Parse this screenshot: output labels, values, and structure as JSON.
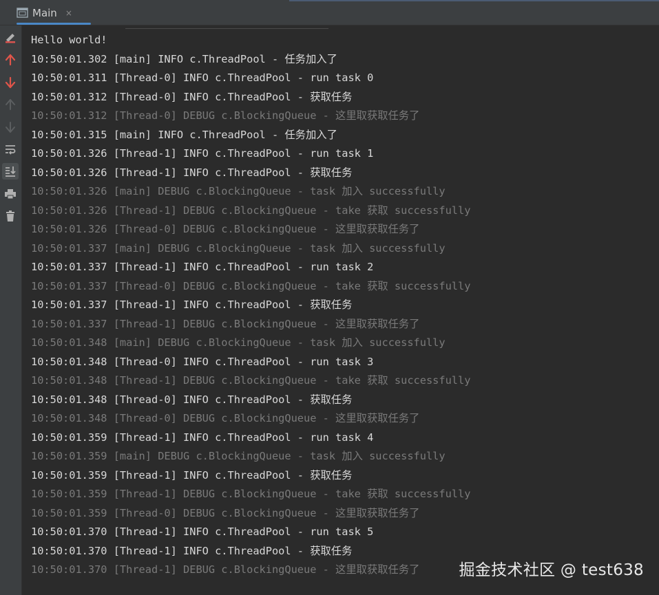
{
  "tab": {
    "title": "Main",
    "close": "×"
  },
  "toolbar": [
    {
      "name": "clear-output-icon",
      "glyph": "✎",
      "color": "#d9534f"
    },
    {
      "name": "arrow-up-red-icon",
      "glyph": "↑",
      "color": "#e0554a"
    },
    {
      "name": "arrow-down-red-icon",
      "glyph": "↓",
      "color": "#e0554a"
    },
    {
      "name": "arrow-up-disabled-icon",
      "glyph": "↑",
      "color": "#5b5e60"
    },
    {
      "name": "arrow-down-disabled-icon",
      "glyph": "↓",
      "color": "#5b5e60"
    },
    {
      "name": "soft-wrap-icon",
      "glyph": "⤶",
      "color": "#b0b0b0"
    },
    {
      "name": "scroll-to-end-icon",
      "glyph": "⤓",
      "color": "#b0b0b0",
      "active": true
    },
    {
      "name": "print-icon",
      "glyph": "⎙",
      "color": "#b0b0b0"
    },
    {
      "name": "trash-icon",
      "glyph": "🗑",
      "color": "#b0b0b0"
    }
  ],
  "console": {
    "lines": [
      {
        "text": "Hello world!",
        "level": "info"
      },
      {
        "text": "10:50:01.302 [main] INFO c.ThreadPool - 任务加入了",
        "level": "info"
      },
      {
        "text": "10:50:01.311 [Thread-0] INFO c.ThreadPool - run task 0",
        "level": "info"
      },
      {
        "text": "10:50:01.312 [Thread-0] INFO c.ThreadPool - 获取任务",
        "level": "info"
      },
      {
        "text": "10:50:01.312 [Thread-0] DEBUG c.BlockingQueue - 这里取获取任务了",
        "level": "debug"
      },
      {
        "text": "10:50:01.315 [main] INFO c.ThreadPool - 任务加入了",
        "level": "info"
      },
      {
        "text": "10:50:01.326 [Thread-1] INFO c.ThreadPool - run task 1",
        "level": "info"
      },
      {
        "text": "10:50:01.326 [Thread-1] INFO c.ThreadPool - 获取任务",
        "level": "info"
      },
      {
        "text": "10:50:01.326 [main] DEBUG c.BlockingQueue - task 加入 successfully",
        "level": "debug"
      },
      {
        "text": "10:50:01.326 [Thread-1] DEBUG c.BlockingQueue - take 获取 successfully",
        "level": "debug"
      },
      {
        "text": "10:50:01.326 [Thread-0] DEBUG c.BlockingQueue - 这里取获取任务了",
        "level": "debug"
      },
      {
        "text": "10:50:01.337 [main] DEBUG c.BlockingQueue - task 加入 successfully",
        "level": "debug"
      },
      {
        "text": "10:50:01.337 [Thread-1] INFO c.ThreadPool - run task 2",
        "level": "info"
      },
      {
        "text": "10:50:01.337 [Thread-0] DEBUG c.BlockingQueue - take 获取 successfully",
        "level": "debug"
      },
      {
        "text": "10:50:01.337 [Thread-1] INFO c.ThreadPool - 获取任务",
        "level": "info"
      },
      {
        "text": "10:50:01.337 [Thread-1] DEBUG c.BlockingQueue - 这里取获取任务了",
        "level": "debug"
      },
      {
        "text": "10:50:01.348 [main] DEBUG c.BlockingQueue - task 加入 successfully",
        "level": "debug"
      },
      {
        "text": "10:50:01.348 [Thread-0] INFO c.ThreadPool - run task 3",
        "level": "info"
      },
      {
        "text": "10:50:01.348 [Thread-1] DEBUG c.BlockingQueue - take 获取 successfully",
        "level": "debug"
      },
      {
        "text": "10:50:01.348 [Thread-0] INFO c.ThreadPool - 获取任务",
        "level": "info"
      },
      {
        "text": "10:50:01.348 [Thread-0] DEBUG c.BlockingQueue - 这里取获取任务了",
        "level": "debug"
      },
      {
        "text": "10:50:01.359 [Thread-1] INFO c.ThreadPool - run task 4",
        "level": "info"
      },
      {
        "text": "10:50:01.359 [main] DEBUG c.BlockingQueue - task 加入 successfully",
        "level": "debug"
      },
      {
        "text": "10:50:01.359 [Thread-1] INFO c.ThreadPool - 获取任务",
        "level": "info"
      },
      {
        "text": "10:50:01.359 [Thread-1] DEBUG c.BlockingQueue - take 获取 successfully",
        "level": "debug"
      },
      {
        "text": "10:50:01.359 [Thread-0] DEBUG c.BlockingQueue - 这里取获取任务了",
        "level": "debug"
      },
      {
        "text": "10:50:01.370 [Thread-1] INFO c.ThreadPool - run task 5",
        "level": "info"
      },
      {
        "text": "10:50:01.370 [Thread-1] INFO c.ThreadPool - 获取任务",
        "level": "info"
      },
      {
        "text": "10:50:01.370 [Thread-1] DEBUG c.BlockingQueue - 这里取获取任务了",
        "level": "debug"
      }
    ]
  },
  "watermark": "掘金技术社区 @ test638",
  "colors": {
    "background": "#2b2b2b",
    "panel": "#3c3f41",
    "info_text": "#d8d8d8",
    "debug_text": "#7a7a7a",
    "tab_accent": "#4a88c7"
  }
}
